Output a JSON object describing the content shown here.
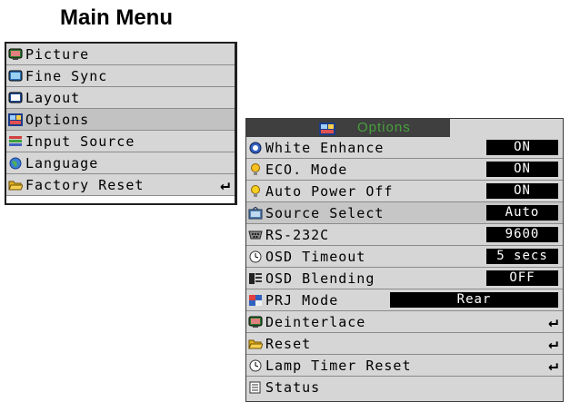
{
  "title": "Main Menu",
  "main_menu": {
    "items": [
      {
        "label": "Picture",
        "icon": "monitor-icon"
      },
      {
        "label": "Fine Sync",
        "icon": "fine-sync-icon"
      },
      {
        "label": "Layout",
        "icon": "layout-icon"
      },
      {
        "label": "Options",
        "icon": "options-icon",
        "selected": true
      },
      {
        "label": "Input Source",
        "icon": "input-source-icon"
      },
      {
        "label": "Language",
        "icon": "globe-icon"
      },
      {
        "label": "Factory Reset",
        "icon": "folder-icon",
        "enter": "↵"
      }
    ]
  },
  "options_menu": {
    "title": "Options",
    "rows": [
      {
        "label": "White Enhance",
        "icon": "white-enhance-icon",
        "value": "ON"
      },
      {
        "label": "ECO. Mode",
        "icon": "bulb-icon",
        "value": "ON"
      },
      {
        "label": "Auto Power Off",
        "icon": "bulb-icon",
        "value": "ON"
      },
      {
        "label": "Source Select",
        "icon": "source-select-icon",
        "value": "Auto",
        "selected": true
      },
      {
        "label": "RS-232C",
        "icon": "rs232c-icon",
        "value": "9600"
      },
      {
        "label": "OSD Timeout",
        "icon": "clock-icon",
        "value": "5 secs"
      },
      {
        "label": "OSD Blending",
        "icon": "blending-icon",
        "value": "OFF"
      },
      {
        "label": "PRJ Mode",
        "icon": "prj-mode-icon",
        "value": "Rear"
      },
      {
        "label": "Deinterlace",
        "icon": "monitor-icon",
        "enter": "↵"
      },
      {
        "label": "Reset",
        "icon": "folder-icon",
        "enter": "↵"
      },
      {
        "label": "Lamp Timer Reset",
        "icon": "clock-icon",
        "enter": "↵"
      },
      {
        "label": "Status",
        "icon": "status-icon"
      }
    ]
  },
  "colors": {
    "accent_title": "#47a03c",
    "menu_bg": "#d6d6d6",
    "value_bg": "#000000"
  }
}
